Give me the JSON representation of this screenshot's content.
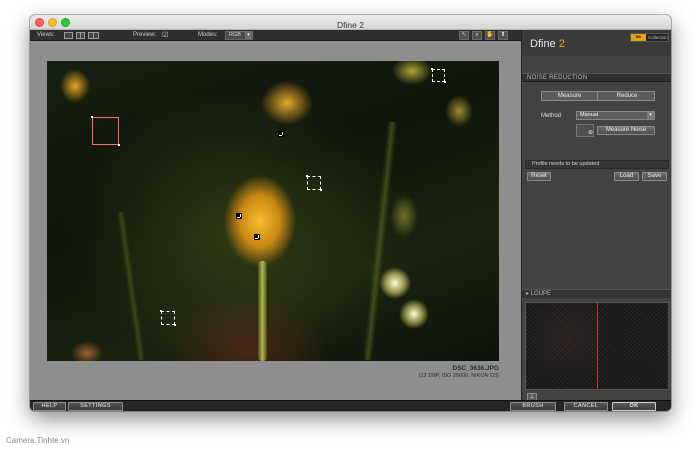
{
  "window": {
    "title": "Dfine 2"
  },
  "toolbar": {
    "views_label": "Views:",
    "preview_label": "Preview:",
    "preview_icon": "checkbox-checked-icon",
    "modes_label": "Modes:",
    "mode_value": "RGB",
    "tools": [
      "arrow-select-icon",
      "zoom-icon",
      "hand-pan-icon",
      "pin-icon"
    ]
  },
  "image": {
    "filename": "DSC_3636.JPG",
    "meta": "(12.1MP, ISO 25600, NIKON D3)"
  },
  "panel": {
    "app_name": "Dfine",
    "app_version": "2",
    "brand_logo": "Nik",
    "brand_text": "Collection",
    "section": "NOISE REDUCTION",
    "tab_measure": "Measure",
    "tab_reduce": "Reduce",
    "method_label": "Method",
    "method_value": "Manual",
    "measure_noise": "Measure Noise",
    "status_message": "Profile needs to be updated",
    "reset": "Reset",
    "load": "Load",
    "save": "Save",
    "loupe_title": "LOUPE"
  },
  "bottom": {
    "help": "HELP",
    "settings": "SETTINGS",
    "brush": "BRUSH",
    "cancel": "CANCEL",
    "ok": "OK"
  },
  "watermark": "Camera.Tinhte.vn",
  "colors": {
    "accent_orange": "#f2a31a",
    "loupe_split_red": "#e12a2a"
  }
}
